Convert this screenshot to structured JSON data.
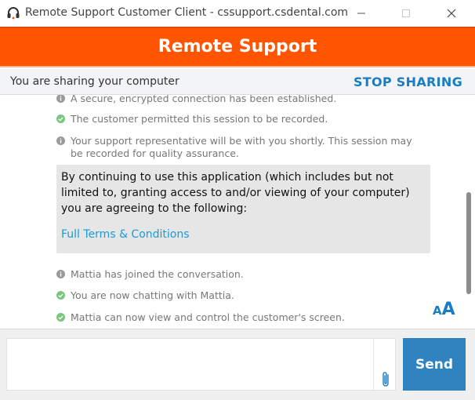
{
  "window": {
    "title": "Remote Support Customer Client - cssupport.csdental.com"
  },
  "banner": {
    "brand": "Remote Support"
  },
  "share_bar": {
    "status": "You are sharing your computer",
    "stop_label": "STOP SHARING"
  },
  "messages": [
    {
      "kind": "info",
      "text": "A secure, encrypted connection has been established."
    },
    {
      "kind": "check",
      "text": "The customer permitted this session to be recorded."
    },
    {
      "kind": "info",
      "text": "Your support representative will be with you shortly. This session may be recorded for quality assurance."
    }
  ],
  "terms": {
    "text": "By continuing to use this application (which includes but not limited to, granting access to and/or viewing of your computer) you are agreeing to the following:",
    "link": "Full Terms & Conditions"
  },
  "messages_after": [
    {
      "kind": "info",
      "text": "Mattia has joined the conversation."
    },
    {
      "kind": "check",
      "text": "You are now chatting with Mattia."
    },
    {
      "kind": "check",
      "text": "Mattia can now view and control the customer's screen."
    }
  ],
  "font_toggle": {
    "small": "A",
    "large": "A"
  },
  "composer": {
    "placeholder": "",
    "send_label": "Send"
  },
  "colors": {
    "brand_orange": "#ff5500",
    "accent_blue": "#1a7cc4",
    "send_blue": "#2f84c0",
    "check_green": "#7bc67e"
  },
  "icons": [
    "headset-icon",
    "minimize-icon",
    "maximize-icon",
    "close-icon",
    "info-icon",
    "check-icon",
    "paperclip-icon"
  ]
}
